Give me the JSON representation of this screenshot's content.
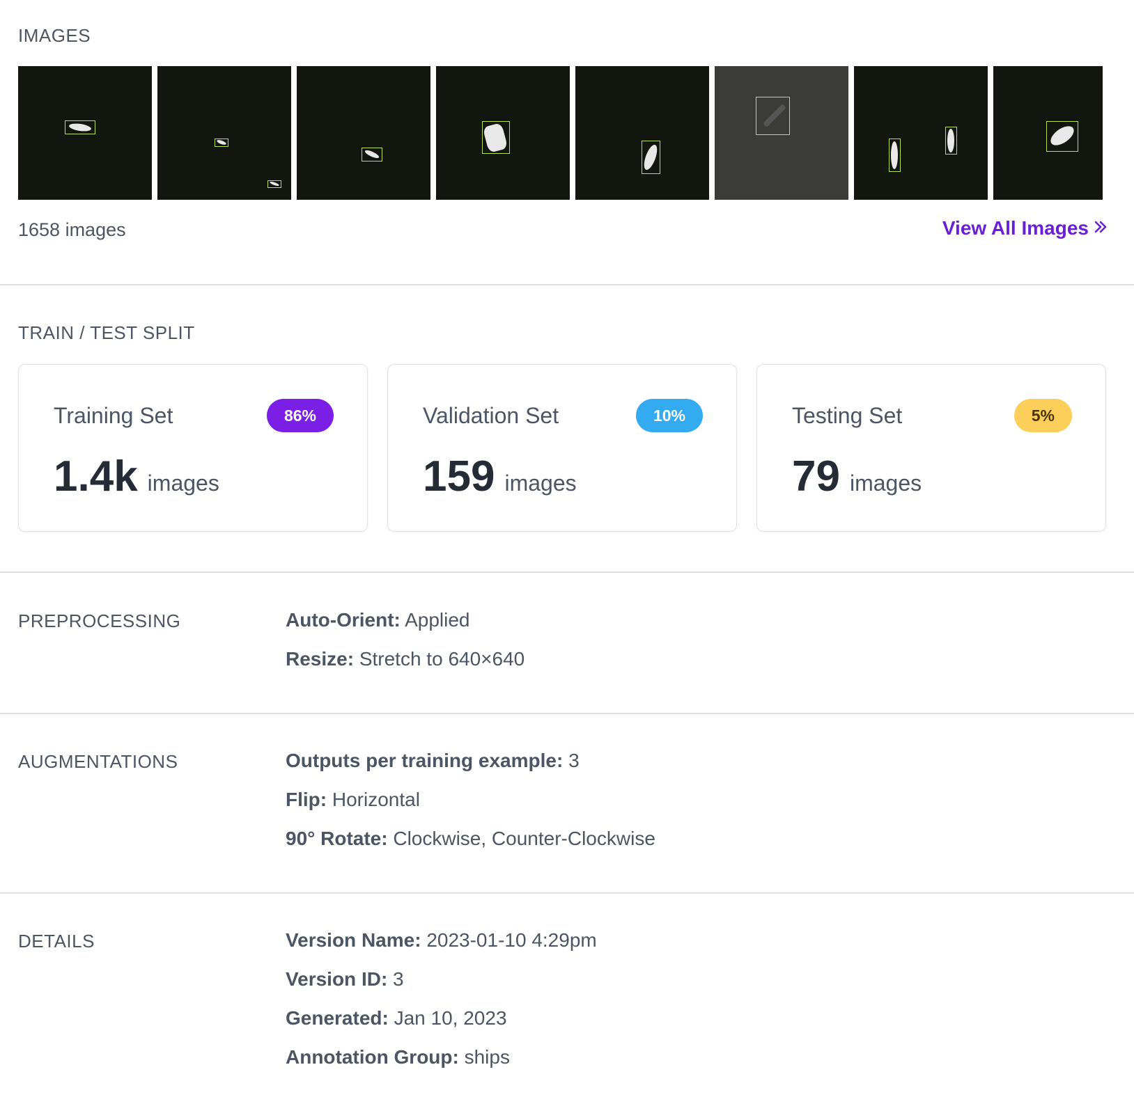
{
  "images": {
    "label": "IMAGES",
    "count_text": "1658 images",
    "view_all_label": "View All Images",
    "view_all_icon": "double-chevron-right-icon"
  },
  "split": {
    "label": "TRAIN / TEST SPLIT",
    "cards": [
      {
        "title": "Training Set",
        "badge": "86%",
        "count": "1.4k",
        "unit": "images",
        "color": "#7c1fe6"
      },
      {
        "title": "Validation Set",
        "badge": "10%",
        "count": "159",
        "unit": "images",
        "color": "#34aaf0"
      },
      {
        "title": "Testing Set",
        "badge": "5%",
        "count": "79",
        "unit": "images",
        "color": "#fccf5a"
      }
    ]
  },
  "preprocessing": {
    "label": "PREPROCESSING",
    "items": [
      {
        "key": "Auto-Orient:",
        "value": "Applied"
      },
      {
        "key": "Resize:",
        "value": "Stretch to 640×640"
      }
    ]
  },
  "augmentations": {
    "label": "AUGMENTATIONS",
    "items": [
      {
        "key": "Outputs per training example:",
        "value": "3"
      },
      {
        "key": "Flip:",
        "value": "Horizontal"
      },
      {
        "key": "90° Rotate:",
        "value": "Clockwise, Counter-Clockwise"
      }
    ]
  },
  "details": {
    "label": "DETAILS",
    "items": [
      {
        "key": "Version Name:",
        "value": "2023-01-10 4:29pm"
      },
      {
        "key": "Version ID:",
        "value": "3"
      },
      {
        "key": "Generated:",
        "value": "Jan 10, 2023"
      },
      {
        "key": "Annotation Group:",
        "value": "ships"
      }
    ]
  }
}
